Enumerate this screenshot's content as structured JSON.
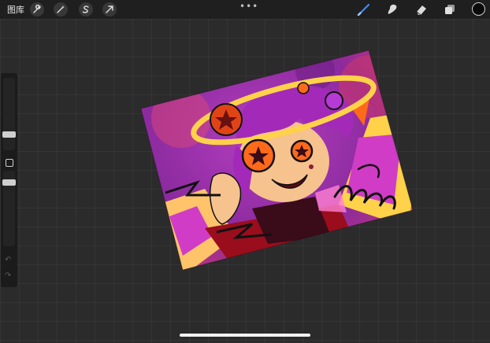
{
  "topbar": {
    "gallery_label": "图库",
    "tools_left": [
      "wrench-icon",
      "magic-wand-icon",
      "selection-icon",
      "transform-arrow-icon"
    ],
    "more_label": "•••",
    "tools_right": [
      "brush-icon",
      "smudge-icon",
      "eraser-icon",
      "layers-icon"
    ],
    "current_color": "#0a0a0a",
    "active_tool_color": "#3b8df5"
  },
  "sidebar": {
    "brush_size": 0.55,
    "opacity": 0.9,
    "undo_icon": "undo-icon",
    "redo_icon": "redo-icon"
  },
  "canvas": {
    "palette": {
      "background_purple": "#8b2a9e",
      "magenta": "#d03cc6",
      "orange": "#ff6a1a",
      "yellow": "#ffd24a",
      "skin": "#f6c28e",
      "hair": "#a32ab8",
      "outline": "#111111"
    }
  }
}
